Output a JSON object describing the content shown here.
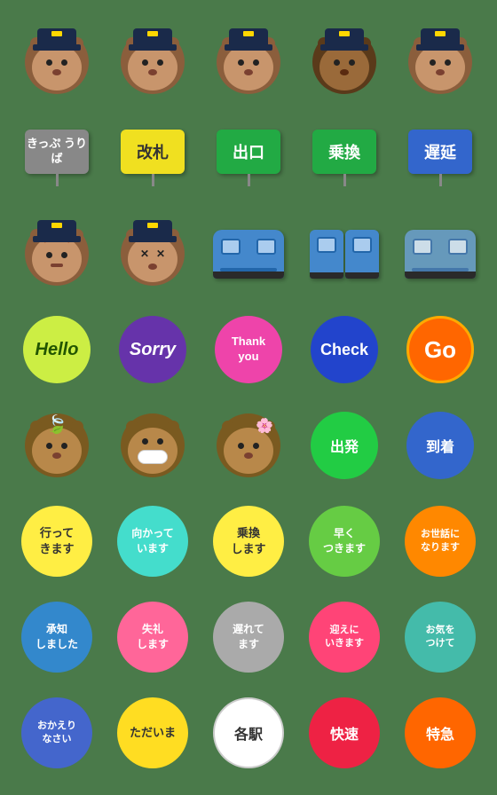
{
  "rows": [
    {
      "id": "row1",
      "items": [
        {
          "type": "bear",
          "variant": "normal",
          "label": "bear-officer-1"
        },
        {
          "type": "bear",
          "variant": "normal",
          "label": "bear-officer-2"
        },
        {
          "type": "bear",
          "variant": "normal",
          "label": "bear-officer-3"
        },
        {
          "type": "bear",
          "variant": "dark",
          "label": "bear-officer-4"
        },
        {
          "type": "bear",
          "variant": "normal",
          "label": "bear-officer-5"
        }
      ]
    },
    {
      "id": "row2",
      "items": [
        {
          "type": "sign",
          "color": "gray",
          "text": "きっぷ\nうりば",
          "label": "ticket-sign"
        },
        {
          "type": "sign",
          "color": "yellow",
          "text": "改札",
          "label": "gate-sign"
        },
        {
          "type": "sign",
          "color": "green",
          "text": "出口",
          "label": "exit-sign"
        },
        {
          "type": "sign",
          "color": "green",
          "text": "乗換",
          "label": "transfer-sign"
        },
        {
          "type": "sign",
          "color": "blue",
          "text": "遅延",
          "label": "delay-sign"
        }
      ]
    },
    {
      "id": "row3",
      "items": [
        {
          "type": "bear",
          "variant": "angry",
          "label": "bear-angry"
        },
        {
          "type": "bear",
          "variant": "xeyes",
          "label": "bear-xeyes"
        },
        {
          "type": "train",
          "variant": "single",
          "label": "train-1"
        },
        {
          "type": "train",
          "variant": "double",
          "label": "train-2"
        },
        {
          "type": "train",
          "variant": "dark",
          "label": "train-3"
        }
      ]
    },
    {
      "id": "row4",
      "items": [
        {
          "type": "badge",
          "style": "yellow-green",
          "text": "Hello",
          "label": "hello-badge"
        },
        {
          "type": "badge",
          "style": "purple",
          "text": "Sorry",
          "label": "sorry-badge"
        },
        {
          "type": "badge",
          "style": "pink",
          "text": "Thank\nyou",
          "label": "thankyou-badge"
        },
        {
          "type": "badge",
          "style": "blue",
          "text": "Check",
          "label": "check-badge"
        },
        {
          "type": "badge",
          "style": "orange",
          "text": "Go",
          "label": "go-badge"
        }
      ]
    },
    {
      "id": "row5",
      "items": [
        {
          "type": "bear",
          "variant": "nature",
          "label": "bear-nature-1"
        },
        {
          "type": "bear",
          "variant": "mask",
          "label": "bear-mask"
        },
        {
          "type": "bear",
          "variant": "flower",
          "label": "bear-flower"
        },
        {
          "type": "badge",
          "style": "green-dep",
          "text": "出発",
          "label": "depart-badge"
        },
        {
          "type": "badge",
          "style": "blue-arr",
          "text": "到着",
          "label": "arrive-badge"
        }
      ]
    },
    {
      "id": "row6",
      "items": [
        {
          "type": "rbadge",
          "style": "yellow",
          "text": "行って\nきます",
          "label": "ikitemasu"
        },
        {
          "type": "rbadge",
          "style": "cyan",
          "text": "向かって\nいます",
          "label": "mukatte"
        },
        {
          "type": "rbadge",
          "style": "yellow",
          "text": "乗換\nします",
          "label": "norikaeshi"
        },
        {
          "type": "rbadge",
          "style": "green2",
          "text": "早く\nつきます",
          "label": "hayaku"
        },
        {
          "type": "rbadge",
          "style": "orange2",
          "text": "お世話に\nなります",
          "label": "osewani"
        }
      ]
    },
    {
      "id": "row7",
      "items": [
        {
          "type": "rbadge",
          "style": "blue2",
          "text": "承知\nしました",
          "label": "shochi"
        },
        {
          "type": "rbadge",
          "style": "pink2",
          "text": "失礼\nします",
          "label": "shitsurei"
        },
        {
          "type": "rbadge",
          "style": "gray2",
          "text": "遅れて\nます",
          "label": "okurete"
        },
        {
          "type": "rbadge",
          "style": "pink3",
          "text": "迎えに\nいきます",
          "label": "mukaeni"
        },
        {
          "type": "rbadge",
          "style": "teal",
          "text": "お気を\nつけて",
          "label": "okio"
        }
      ]
    },
    {
      "id": "row8",
      "items": [
        {
          "type": "rbadge",
          "style": "blue3",
          "text": "おかえり\nなさい",
          "label": "okaeri"
        },
        {
          "type": "rbadge",
          "style": "yellow2",
          "text": "ただいま",
          "label": "tadaima"
        },
        {
          "type": "rbadge",
          "style": "white",
          "text": "各駅",
          "label": "kakueki"
        },
        {
          "type": "rbadge",
          "style": "red",
          "text": "快速",
          "label": "kaisoku"
        },
        {
          "type": "rbadge",
          "style": "orange3",
          "text": "特急",
          "label": "tokkyu"
        }
      ]
    }
  ]
}
